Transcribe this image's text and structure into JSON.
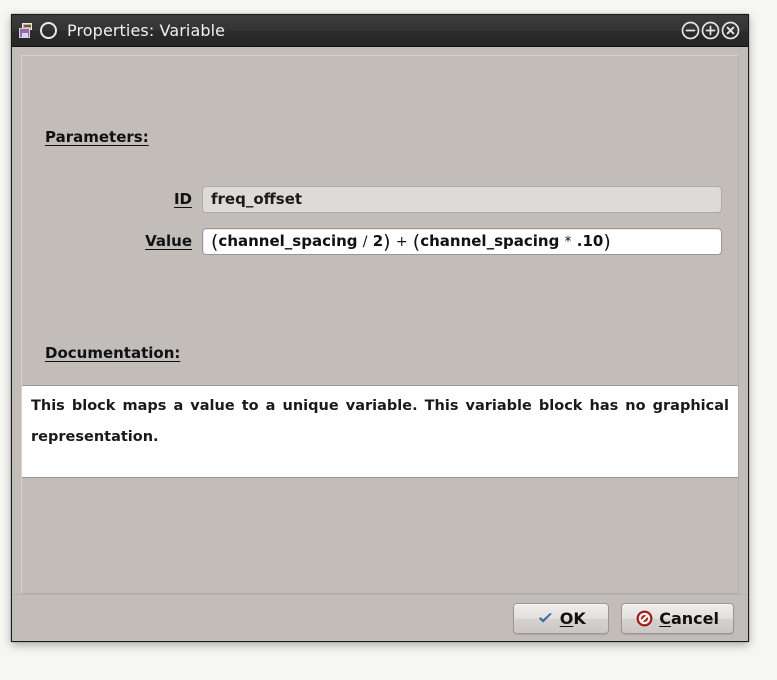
{
  "window": {
    "title": "Properties: Variable",
    "app_icon": "variable-block-icon",
    "status_glyph": "circle-icon",
    "controls": [
      {
        "name": "minimize-button",
        "glyph": "minus-circle-icon",
        "label": "Minimize"
      },
      {
        "name": "maximize-button",
        "glyph": "plus-circle-icon",
        "label": "Maximize"
      },
      {
        "name": "close-button",
        "glyph": "close-circle-icon",
        "label": "Close"
      }
    ]
  },
  "sections": {
    "parameters_label": "Parameters:",
    "documentation_label": "Documentation:"
  },
  "parameters": [
    {
      "name": "id",
      "label": "ID",
      "value": "freq_offset",
      "placeholder": "",
      "readonly": true
    },
    {
      "name": "value",
      "label": "Value",
      "value": "(channel_spacing / 2) + (channel_spacing * .10)",
      "placeholder": "",
      "readonly": false,
      "tokens": [
        {
          "t": "(",
          "k": "paren"
        },
        {
          "t": "channel_spacing",
          "k": "ident"
        },
        {
          "t": "/",
          "k": "op"
        },
        {
          "t": "2",
          "k": "num"
        },
        {
          "t": ")",
          "k": "paren"
        },
        {
          "t": "+",
          "k": "op"
        },
        {
          "t": "(",
          "k": "paren"
        },
        {
          "t": "channel_spacing",
          "k": "ident"
        },
        {
          "t": "*",
          "k": "op"
        },
        {
          "t": ".10",
          "k": "num"
        },
        {
          "t": ")",
          "k": "paren"
        }
      ]
    }
  ],
  "documentation": {
    "text": "This block maps a value to a unique variable. This variable block has no graphical representation."
  },
  "buttons": {
    "ok": {
      "label": "OK",
      "accel": "O",
      "icon": "check-icon",
      "icon_color": "#3c6ea5"
    },
    "cancel": {
      "label": "Cancel",
      "accel": "C",
      "icon": "no-entry-icon",
      "icon_color": "#c0241c"
    }
  },
  "colors": {
    "titlebar": "#2e2e2e",
    "dialog_background": "#c3bdba",
    "field_readonly": "#dddbd8",
    "field_editable": "#ffffff",
    "text": "#111111",
    "ok_icon": "#3c6ea5",
    "cancel_icon": "#c0241c"
  }
}
